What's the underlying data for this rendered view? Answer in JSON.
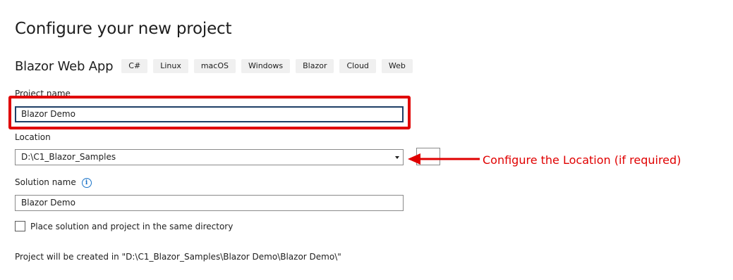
{
  "page": {
    "title": "Configure your new project"
  },
  "template": {
    "name": "Blazor Web App",
    "tags": [
      "C#",
      "Linux",
      "macOS",
      "Windows",
      "Blazor",
      "Cloud",
      "Web"
    ]
  },
  "project_name": {
    "label": "Project name",
    "value": "Blazor Demo"
  },
  "location": {
    "label": "Location",
    "value": "D:\\C1_Blazor_Samples"
  },
  "solution_name": {
    "label": "Solution name",
    "value": "Blazor Demo"
  },
  "same_directory": {
    "label": "Place solution and project in the same directory",
    "checked": false
  },
  "created_in": "Project will be created in \"D:\\C1_Blazor_Samples\\Blazor Demo\\Blazor Demo\\\"",
  "annotation": {
    "text": "Configure the Location (if required)",
    "color": "#e00000"
  },
  "icons": {
    "info": "info-icon",
    "dropdown": "chevron-down-icon"
  }
}
